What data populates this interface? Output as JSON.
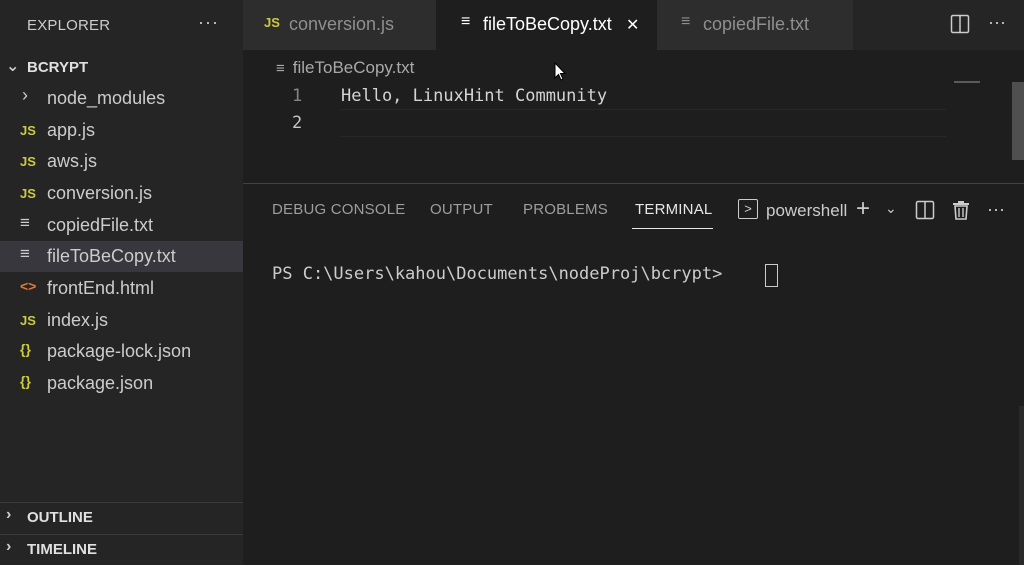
{
  "explorer": {
    "title": "EXPLORER",
    "more": "···",
    "folder": "BCRYPT",
    "files": [
      {
        "name": "node_modules",
        "icon": "chevron-right-icon",
        "glyph": "›"
      },
      {
        "name": "app.js",
        "icon": "js-file-icon",
        "glyph": "JS"
      },
      {
        "name": "aws.js",
        "icon": "js-file-icon",
        "glyph": "JS"
      },
      {
        "name": "conversion.js",
        "icon": "js-file-icon",
        "glyph": "JS"
      },
      {
        "name": "copiedFile.txt",
        "icon": "text-file-icon",
        "glyph": "≡"
      },
      {
        "name": "fileToBeCopy.txt",
        "icon": "text-file-icon",
        "glyph": "≡"
      },
      {
        "name": "frontEnd.html",
        "icon": "html-file-icon",
        "glyph": "<>"
      },
      {
        "name": "index.js",
        "icon": "js-file-icon",
        "glyph": "JS"
      },
      {
        "name": "package-lock.json",
        "icon": "json-file-icon",
        "glyph": "{}"
      },
      {
        "name": "package.json",
        "icon": "json-file-icon",
        "glyph": "{}"
      }
    ],
    "outline": "OUTLINE",
    "timeline": "TIMELINE"
  },
  "tabs": {
    "conversion": {
      "label": "conversion.js",
      "glyph": "JS"
    },
    "filetobe": {
      "label": "fileToBeCopy.txt",
      "glyph": "≡",
      "close": "✕"
    },
    "copied": {
      "label": "copiedFile.txt",
      "glyph": "≡"
    },
    "more": "···"
  },
  "editor": {
    "breadcrumb": "fileToBeCopy.txt",
    "breadcrumb_glyph": "≡",
    "lines": [
      {
        "no": "1",
        "text": "Hello, LinuxHint Community"
      },
      {
        "no": "2",
        "text": ""
      }
    ]
  },
  "panel": {
    "tabs": [
      "DEBUG CONSOLE",
      "OUTPUT",
      "PROBLEMS",
      "TERMINAL"
    ],
    "terminal_name": "powershell",
    "terminal_glyph": ">",
    "plus": "+",
    "dropdown": "⌄",
    "more": "···",
    "prompt": "PS C:\\Users\\kahou\\Documents\\nodeProj\\bcrypt>"
  },
  "colors": {
    "background": "#1e1e1e",
    "sidebar": "#252526",
    "js_icon": "#cbcb41",
    "html_icon": "#e37933",
    "active_row": "#37373d"
  }
}
